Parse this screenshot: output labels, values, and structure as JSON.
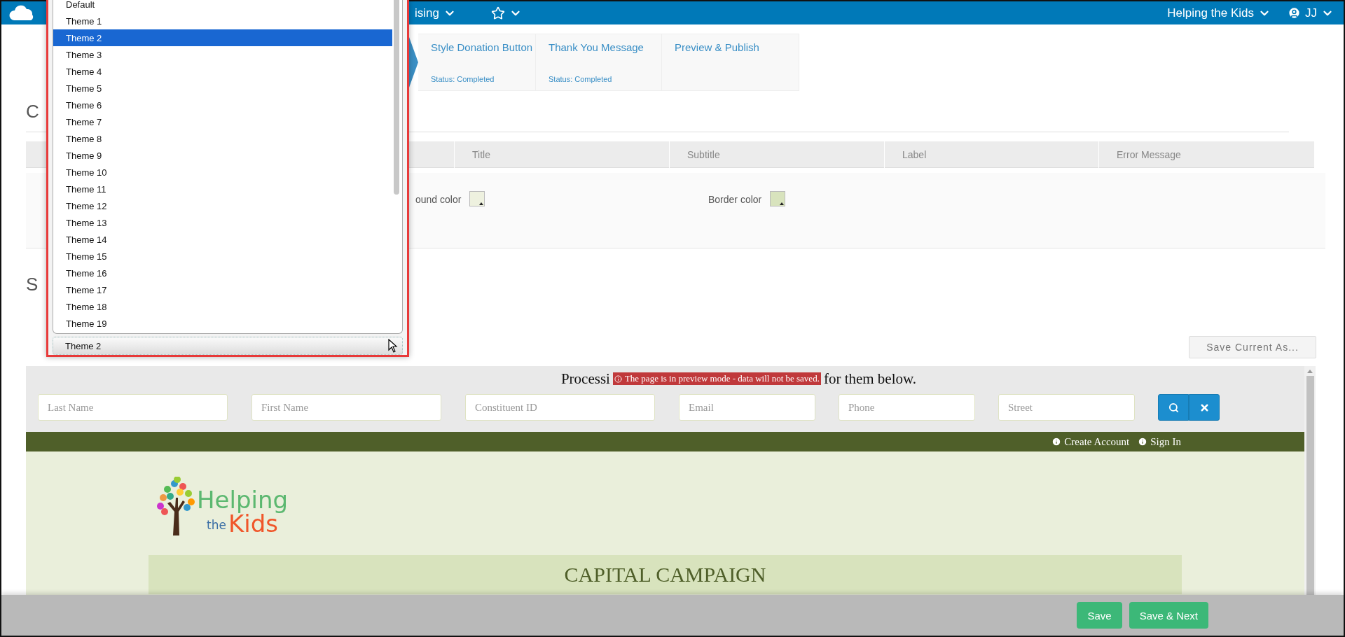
{
  "top_nav": {
    "menu_label": "ising",
    "org": "Helping the Kids",
    "user": "JJ"
  },
  "steps": [
    {
      "title": "Style Donation Button",
      "status": "Status: Completed",
      "selected": false
    },
    {
      "title": "Thank You Message",
      "status": "Status: Completed",
      "selected": false
    },
    {
      "title": "Preview & Publish",
      "selected": false
    }
  ],
  "sections": [
    {
      "heading": "C"
    },
    {
      "heading": "S"
    }
  ],
  "table": {
    "columns": [
      "Title",
      "Subtitle",
      "Label",
      "Error Message"
    ],
    "fields": [
      {
        "label": "ound color",
        "color": "#eef1df"
      },
      {
        "label": "Border color",
        "color": "#d8e3bd"
      }
    ]
  },
  "save_as_button": "Save Current As...",
  "theme_dropdown": {
    "value": "Theme 2",
    "options": [
      {
        "label": "Default",
        "selected": false
      },
      {
        "label": "Theme 1",
        "selected": false
      },
      {
        "label": "Theme 2",
        "selected": true
      },
      {
        "label": "Theme 3",
        "selected": false
      },
      {
        "label": "Theme 4",
        "selected": false
      },
      {
        "label": "Theme 5",
        "selected": false
      },
      {
        "label": "Theme 6",
        "selected": false
      },
      {
        "label": "Theme 7",
        "selected": false
      },
      {
        "label": "Theme 8",
        "selected": false
      },
      {
        "label": "Theme 9",
        "selected": false
      },
      {
        "label": "Theme 10",
        "selected": false
      },
      {
        "label": "Theme 11",
        "selected": false
      },
      {
        "label": "Theme 12",
        "selected": false
      },
      {
        "label": "Theme 13",
        "selected": false
      },
      {
        "label": "Theme 14",
        "selected": false
      },
      {
        "label": "Theme 15",
        "selected": false
      },
      {
        "label": "Theme 16",
        "selected": false
      },
      {
        "label": "Theme 17",
        "selected": false
      },
      {
        "label": "Theme 18",
        "selected": false
      },
      {
        "label": "Theme 19",
        "selected": false
      }
    ]
  },
  "preview": {
    "heading_start": "Processi",
    "heading_end": "for them below.",
    "notice": "The page is in preview mode - data will not be saved.",
    "search_fields": [
      {
        "placeholder": "Last Name"
      },
      {
        "placeholder": "First Name"
      },
      {
        "placeholder": "Constituent ID"
      },
      {
        "placeholder": "Email"
      },
      {
        "placeholder": "Phone"
      },
      {
        "placeholder": "Street"
      }
    ],
    "account_links": [
      "Create Account",
      "Sign In"
    ],
    "logo": {
      "line1": "Helping",
      "line2": "the",
      "line3": "Kids"
    },
    "banner": "CAPITAL CAMPAIGN"
  },
  "footer_buttons": [
    "Save",
    "Save & Next"
  ]
}
